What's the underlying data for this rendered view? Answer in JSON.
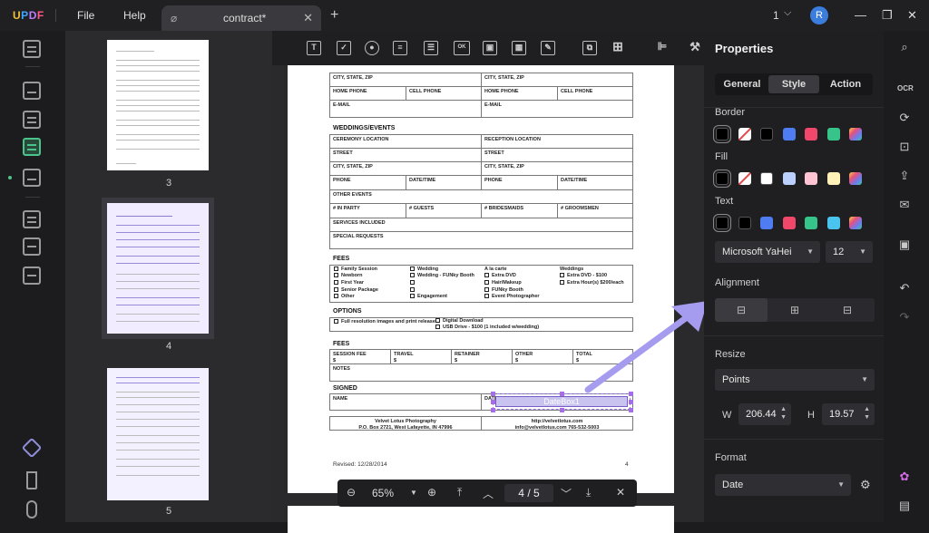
{
  "app": {
    "logo": "UPDF",
    "menu": [
      "File",
      "Help"
    ]
  },
  "tab": {
    "title": "contract*",
    "close": "✕",
    "new": "+"
  },
  "window": {
    "page_count": "1",
    "chevron": "⌵",
    "avatar": "R",
    "minimize": "—",
    "restore": "❐",
    "close": "✕"
  },
  "thumbnails": [
    {
      "label": "3"
    },
    {
      "label": "4"
    },
    {
      "label": "5"
    }
  ],
  "form": {
    "row_city1": "CITY, STATE, ZIP",
    "row_city2": "CITY, STATE, ZIP",
    "home_phone": "HOME PHONE",
    "cell_phone": "CELL PHONE",
    "email": "E-MAIL",
    "weddings_title": "WEDDINGS/EVENTS",
    "ceremony": "CEREMONY LOCATION",
    "reception": "RECEPTION LOCATION",
    "street": "STREET",
    "city": "CITY, STATE, ZIP",
    "phone": "PHONE",
    "datetime": "DATE/TIME",
    "other_events": "OTHER EVENTS",
    "in_party": "# IN PARTY",
    "guests": "# GUESTS",
    "bridesmaids": "# BRIDESMAIDS",
    "groomsmen": "# GROOMSMEN",
    "services": "SERVICES INCLUDED",
    "special": "SPECIAL REQUESTS",
    "fees_title": "FEES",
    "col1": [
      "Family Session",
      "Newborn",
      "First Year",
      "Senior Package",
      "Other"
    ],
    "col2": [
      "Wedding",
      "Wedding - FUNky Booth",
      "",
      "",
      "Engagement"
    ],
    "col3_head": "A la carte",
    "col3": [
      "Extra DVD",
      "Hair/Makeup",
      "FUNky Booth",
      "Event Photographer"
    ],
    "col4_head": "Weddings",
    "col4": [
      "Extra DVD - $100",
      "Extra Hour(s) $200/each"
    ],
    "options_title": "OPTIONS",
    "opt1": "Full resolution images and print release",
    "opt2": "Digital Download",
    "opt3": "USB Drive - $100 (1 included w/wedding)",
    "fees2_title": "FEES",
    "session_fee": "SESSION FEE",
    "travel": "TRAVEL",
    "retainer": "RETAINER",
    "other": "OTHER",
    "total": "TOTAL",
    "dollar": "$",
    "notes": "NOTES",
    "signed_title": "SIGNED",
    "name": "NAME",
    "date": "DATE",
    "datebox": "DateBox1",
    "footer_left1": "Velvet Lotus Photography",
    "footer_left2": "P.O. Box 2721, West Lafayette, IN 47996",
    "footer_right1": "http://velvetlotus.com",
    "footer_right2": "info@velvetlotus.com 765-532-5003",
    "revised": "Revised: 12/28/2014",
    "page_no": "4"
  },
  "nav": {
    "zoom": "65%",
    "page_current": "4",
    "page_sep": "/",
    "page_total": "5"
  },
  "properties": {
    "title": "Properties",
    "tabs": [
      "General",
      "Style",
      "Action"
    ],
    "active_tab": "Style",
    "border_label": "Border",
    "fill_label": "Fill",
    "text_label": "Text",
    "border_colors": [
      "#000000",
      "none",
      "#000000",
      "#4f7cf0",
      "#f0476a",
      "#37c48a",
      "gradient"
    ],
    "fill_colors": [
      "#000000",
      "none",
      "#ffffff",
      "#bcd0ff",
      "#ffc3d3",
      "#fff1b8",
      "gradient"
    ],
    "text_colors": [
      "#000000",
      "#000000",
      "#4f7cf0",
      "#f0476a",
      "#37c48a",
      "#4bc3ef",
      "gradient"
    ],
    "font": "Microsoft YaHei",
    "font_size": "12",
    "alignment_label": "Alignment",
    "resize_label": "Resize",
    "unit": "Points",
    "w_label": "W",
    "w_value": "206.44",
    "h_label": "H",
    "h_value": "19.57",
    "format_label": "Format",
    "format_value": "Date"
  }
}
